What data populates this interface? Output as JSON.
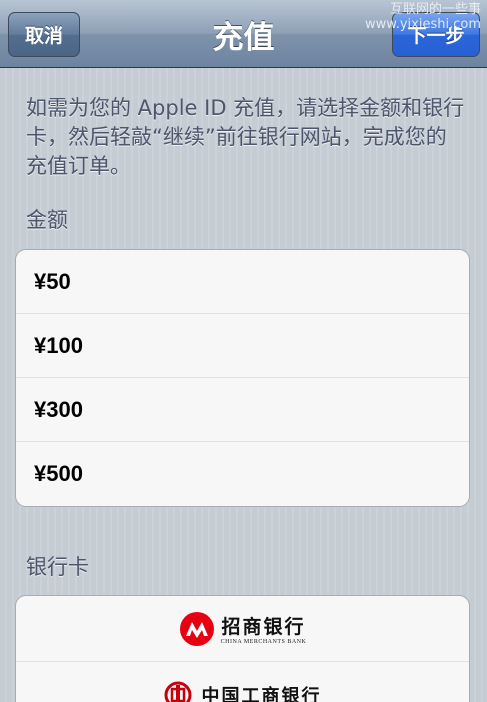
{
  "navbar": {
    "cancel_label": "取消",
    "title": "充值",
    "next_label": "下一步",
    "watermark_line1": "互联网的一些事",
    "watermark_line2": "www.yixieshi.com"
  },
  "intro_text": "如需为您的 Apple ID 充值，请选择金额和银行卡，然后轻敲“继续”前往银行网站，完成您的充值订单。",
  "amount": {
    "label": "金额",
    "options": [
      "¥50",
      "¥100",
      "¥300",
      "¥500"
    ]
  },
  "bank": {
    "label": "银行卡",
    "cards": [
      {
        "name": "招商银行",
        "subtitle": "CHINA MERCHANTS BANK"
      },
      {
        "name": "中国工商银行"
      }
    ]
  },
  "colors": {
    "cmb_red": "#e60012",
    "icbc_red": "#c7000b",
    "next_button_blue": "#2b66d8"
  }
}
